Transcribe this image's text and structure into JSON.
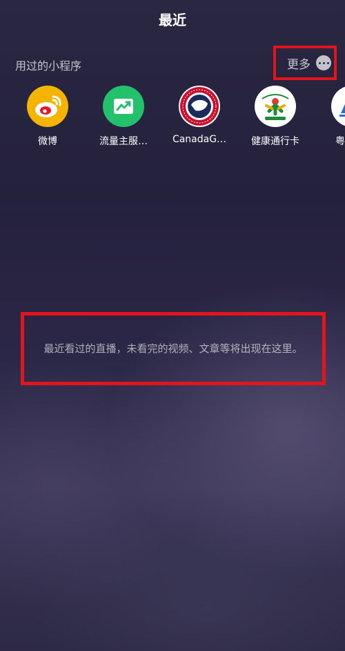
{
  "header": {
    "title": "最近"
  },
  "section": {
    "label": "用过的小程序"
  },
  "more": {
    "label": "更多",
    "icon": "more-dots-icon"
  },
  "apps": [
    {
      "label": "微博",
      "icon": "weibo-icon",
      "color": "#f4b400"
    },
    {
      "label": "流量主服…",
      "icon": "trend-chart-icon",
      "color": "#24c16d"
    },
    {
      "label": "CanadaG…",
      "icon": "canada-goose-badge-icon",
      "color": "#c8102e"
    },
    {
      "label": "健康通行卡",
      "icon": "health-pass-icon",
      "color": "#1f8a3a"
    },
    {
      "label": "粤",
      "icon": "guangdong-app-icon",
      "color": "#2a6cc7"
    }
  ],
  "empty_message": "最近看过的直播，未看完的视频、文章等将出现在这里。"
}
